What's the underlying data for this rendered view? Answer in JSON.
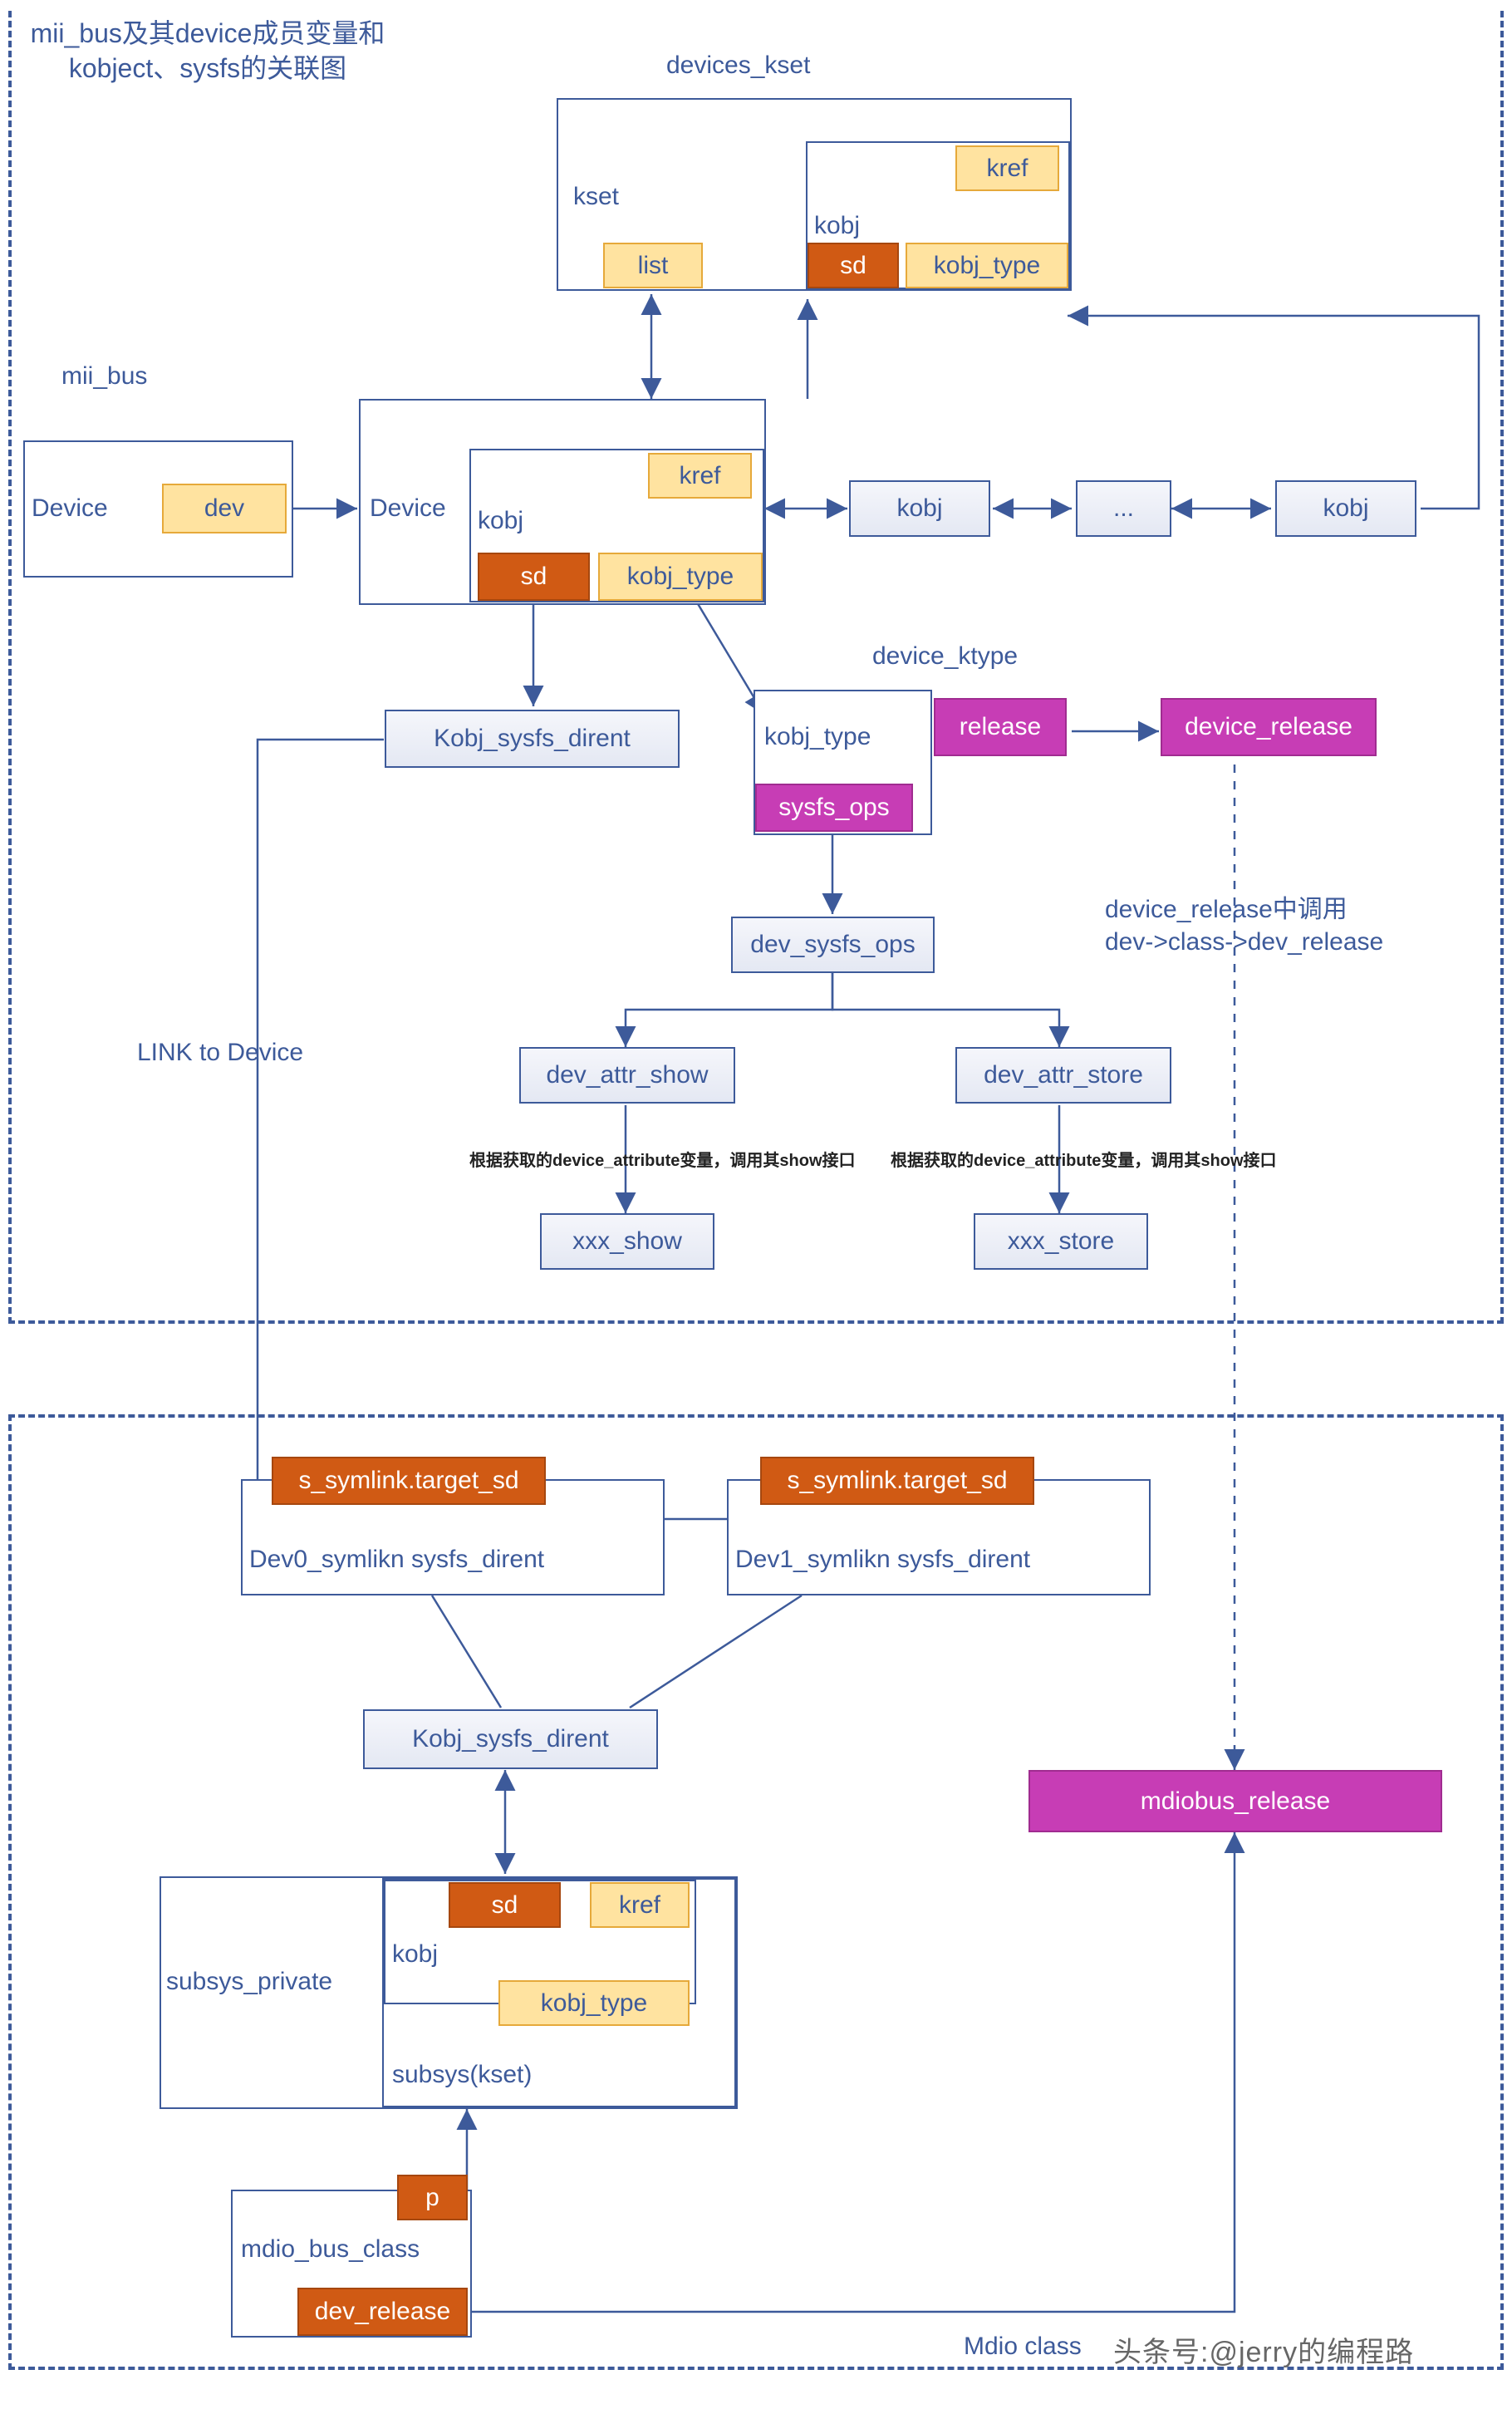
{
  "title_wrap": "mii_bus及其device成员变量和kobject、sysfs的关联图",
  "top": {
    "devices_kset": "devices_kset",
    "kset": "kset",
    "list": "list",
    "kobj": "kobj",
    "sd": "sd",
    "kref": "kref",
    "kobj_type": "kobj_type"
  },
  "mii_bus": "mii_bus",
  "left_device": {
    "Device": "Device",
    "dev": "dev"
  },
  "mid_device": {
    "Device": "Device",
    "kobj": "kobj",
    "sd": "sd",
    "kref": "kref",
    "kobj_type": "kobj_type"
  },
  "kobj_list": {
    "kobj1": "kobj",
    "ellipsis": "...",
    "kobj2": "kobj"
  },
  "sysfs_dirent_mid": "Kobj_sysfs_dirent",
  "device_ktype": "device_ktype",
  "kt": {
    "kobj_type": "kobj_type",
    "sysfs_ops": "sysfs_ops",
    "release": "release",
    "device_release": "device_release"
  },
  "release_note": "device_release中调用\ndev->class->dev_release",
  "dev_sysfs_ops": "dev_sysfs_ops",
  "dev_attr_show": "dev_attr_show",
  "dev_attr_store": "dev_attr_store",
  "attr_note": "根据获取的device_attribute变量，调用其show接口",
  "xxx_show": "xxx_show",
  "xxx_store": "xxx_store",
  "link_to_device": "LINK to Device",
  "symlink": {
    "target0": "s_symlink.target_sd",
    "dev0": "Dev0_symlikn sysfs_dirent",
    "target1": "s_symlink.target_sd",
    "dev1": "Dev1_symlikn sysfs_dirent"
  },
  "bottom_sysfs_dirent": "Kobj_sysfs_dirent",
  "mdiobus_release": "mdiobus_release",
  "subsys": {
    "subsys_private": "subsys_private",
    "kobj": "kobj",
    "sd": "sd",
    "kref": "kref",
    "kobj_type": "kobj_type",
    "subsys_kset": "subsys(kset)"
  },
  "mdio_class": {
    "mdio_bus_class": "mdio_bus_class",
    "p": "p",
    "dev_release": "dev_release"
  },
  "mdio_class_caption": "Mdio class",
  "watermark": "头条号:@jerry的编程路"
}
